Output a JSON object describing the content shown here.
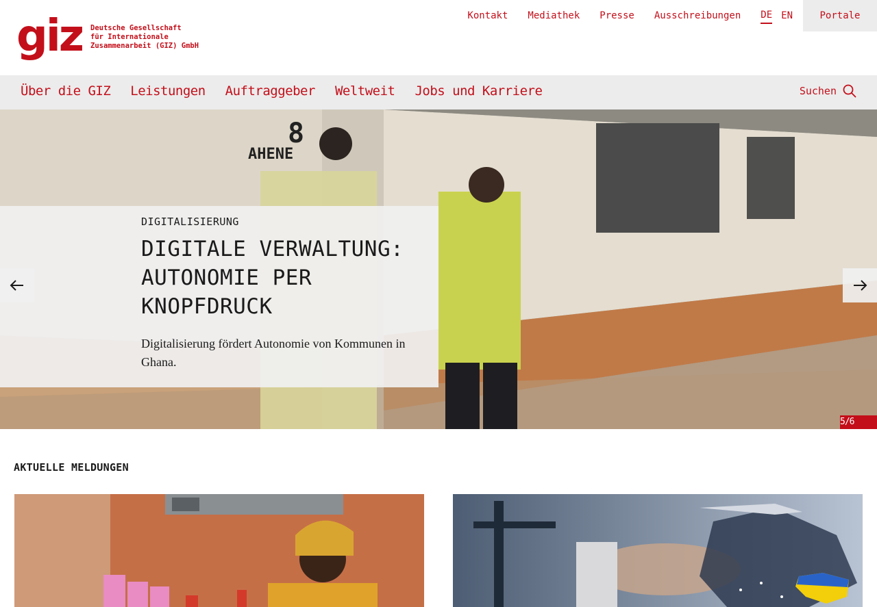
{
  "logo": {
    "mark": "giz",
    "lines": [
      "Deutsche Gesellschaft",
      "für Internationale",
      "Zusammenarbeit (GIZ) GmbH"
    ]
  },
  "service_nav": {
    "links": [
      "Kontakt",
      "Mediathek",
      "Presse",
      "Ausschreibungen"
    ],
    "languages": {
      "de": "DE",
      "en": "EN",
      "active": "DE"
    },
    "portale": "Portale"
  },
  "main_nav": {
    "items": [
      "Über die GIZ",
      "Leistungen",
      "Auftraggeber",
      "Weltweit",
      "Jobs und Karriere"
    ],
    "search_label": "Suchen"
  },
  "hero": {
    "kicker": "DIGITALISIERUNG",
    "headline": "DIGITALE VERWALTUNG: AUTONOMIE PER KNOPFDRUCK",
    "teaser": "Digitalisierung fördert Autonomie von Kommunen in Ghana.",
    "slide_counter": "5/6",
    "wall_text": "AHENE",
    "wall_number": "8"
  },
  "news": {
    "heading": "AKTUELLE MELDUNGEN"
  },
  "colors": {
    "brand": "#c30f1a",
    "nav_bg": "#ececec",
    "caption_bg": "#f0f0f0"
  },
  "icons": {
    "search": "magnifier-icon",
    "prev": "arrow-left-icon",
    "next": "arrow-right-icon"
  }
}
